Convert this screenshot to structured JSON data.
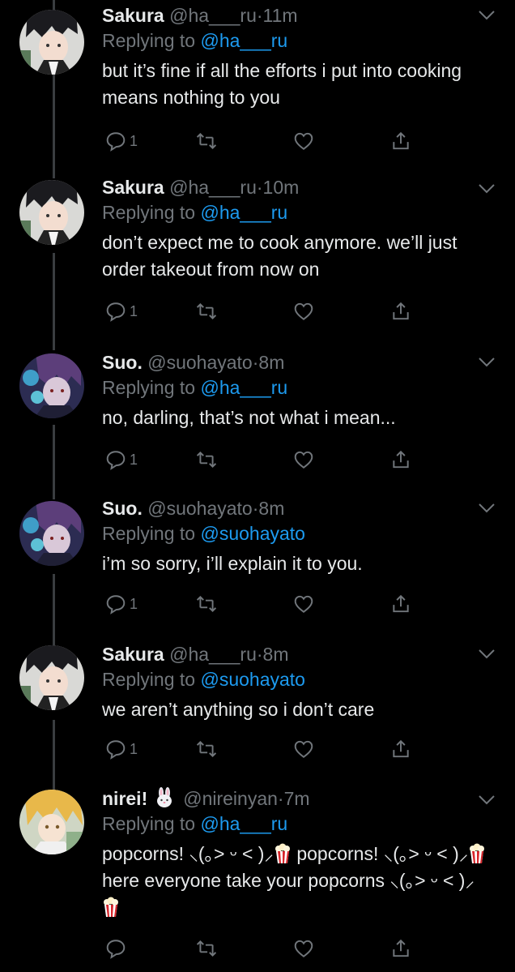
{
  "tweets": [
    {
      "name": "Sakura",
      "handle": "@ha___ru",
      "dot": "·",
      "time": "11m",
      "replying_label": "Replying to ",
      "replying_to": "@ha___ru",
      "text": "but it’s fine if all the efforts i put into cooking means nothing to you",
      "reply_count": "1",
      "avatar": "sakura"
    },
    {
      "name": "Sakura",
      "handle": "@ha___ru",
      "dot": "·",
      "time": "10m",
      "replying_label": "Replying to ",
      "replying_to": "@ha___ru",
      "text": "don’t expect me to cook anymore. we’ll just order takeout from now on",
      "reply_count": "1",
      "avatar": "sakura"
    },
    {
      "name": "Suo.",
      "handle": "@suohayato",
      "dot": "·",
      "time": "8m",
      "replying_label": "Replying to ",
      "replying_to": "@ha___ru",
      "text": "no, darling, that’s not what i mean...",
      "reply_count": "1",
      "avatar": "suo"
    },
    {
      "name": "Suo.",
      "handle": "@suohayato",
      "dot": "·",
      "time": "8m",
      "replying_label": "Replying to ",
      "replying_to": "@suohayato",
      "text": "i’m so sorry, i’ll explain it to you.",
      "reply_count": "1",
      "avatar": "suo"
    },
    {
      "name": "Sakura",
      "handle": "@ha___ru",
      "dot": "·",
      "time": "8m",
      "replying_label": "Replying to ",
      "replying_to": "@suohayato",
      "text": "we aren’t anything so i don’t care",
      "reply_count": "1",
      "avatar": "sakura"
    },
    {
      "name": "nirei!",
      "name_emoji": "rabbit-face-icon",
      "handle": "@nireinyan",
      "dot": "·",
      "time": "7m",
      "replying_label": "Replying to ",
      "replying_to": "@ha___ru",
      "text_parts": [
        "popcorns! ⸜(｡˃ ᵕ ˂ )⸝",
        " popcorns! ⸜(｡˃ ᵕ ˂ )⸝",
        " here everyone take your popcorns ⸜(｡˃ ᵕ ˂ )⸝"
      ],
      "text_icon": "popcorn-icon",
      "reply_count": "",
      "avatar": "nirei"
    }
  ],
  "icons": {
    "reply": "reply-icon",
    "retweet": "retweet-icon",
    "like": "heart-icon",
    "share": "share-icon",
    "more": "chevron-down-icon"
  },
  "colors": {
    "background": "#000000",
    "text": "#e7e9ea",
    "secondary": "#71767b",
    "link": "#1d9bf0",
    "thread_line": "#3a3d40"
  }
}
